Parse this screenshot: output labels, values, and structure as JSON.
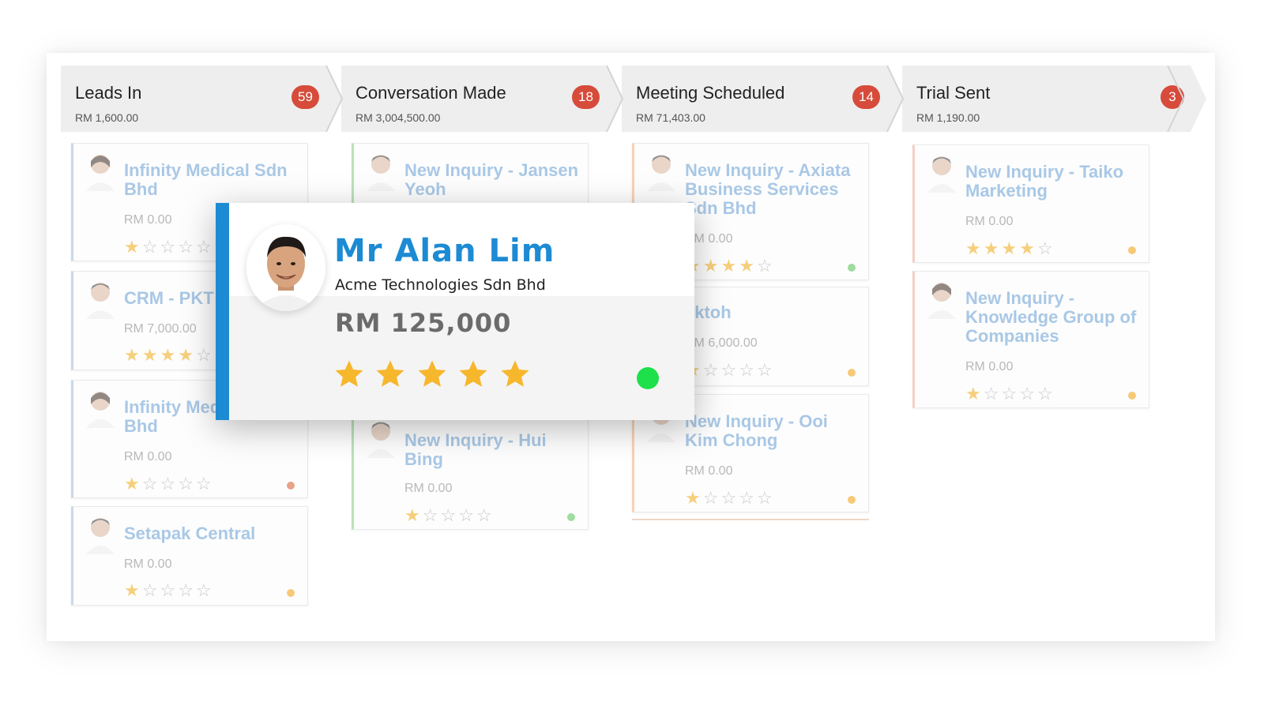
{
  "stages": [
    {
      "title": "Leads In",
      "amount": "RM 1,600.00",
      "count": "59"
    },
    {
      "title": "Conversation Made",
      "amount": "RM 3,004,500.00",
      "count": "18"
    },
    {
      "title": "Meeting Scheduled",
      "amount": "RM 71,403.00",
      "count": "14"
    },
    {
      "title": "Trial Sent",
      "amount": "RM 1,190.00",
      "count": "3"
    }
  ],
  "cards": [
    {
      "title": "Infinity Medical Sdn Bhd",
      "amount": "RM 0.00",
      "rating": 1,
      "status_color": ""
    },
    {
      "title": "CRM - PKT",
      "amount": "RM 7,000.00",
      "rating": 4,
      "status_color": ""
    },
    {
      "title": "Infinity Medical Sdn Bhd",
      "amount": "RM 0.00",
      "rating": 1,
      "status_color": "#e8a28a"
    },
    {
      "title": "Setapak Central",
      "amount": "RM 0.00",
      "rating": 1,
      "status_color": "#f7c977"
    },
    {
      "title": "New Inquiry - Jansen Yeoh",
      "amount": "",
      "rating": 0,
      "status_color": ""
    },
    {
      "title": "New Inquiry - Hui Bing",
      "amount": "RM 0.00",
      "rating": 1,
      "status_color": "#9fdc9f"
    },
    {
      "title": "New Inquiry - Axiata Business Services Sdn Bhd",
      "amount": "RM 0.00",
      "rating": 4,
      "status_color": "#9fdc9f"
    },
    {
      "title": "yktoh",
      "amount": "RM 6,000.00",
      "rating": 1,
      "status_color": "#f7c977"
    },
    {
      "title": "New Inquiry - Ooi Kim Chong",
      "amount": "RM 0.00",
      "rating": 1,
      "status_color": "#f7c977"
    },
    {
      "title": "New Inquiry - Taiko Marketing",
      "amount": "RM 0.00",
      "rating": 4,
      "status_color": "#f7c977"
    },
    {
      "title": "New Inquiry - Knowledge Group of Companies",
      "amount": "RM 0.00",
      "rating": 1,
      "status_color": "#f7c977"
    }
  ],
  "popup": {
    "name": "Mr Alan Lim",
    "company": "Acme Technologies Sdn Bhd",
    "amount": "RM 125,000",
    "rating": 5,
    "status_color": "#1de04a",
    "accent_color": "#1d8bd3"
  }
}
